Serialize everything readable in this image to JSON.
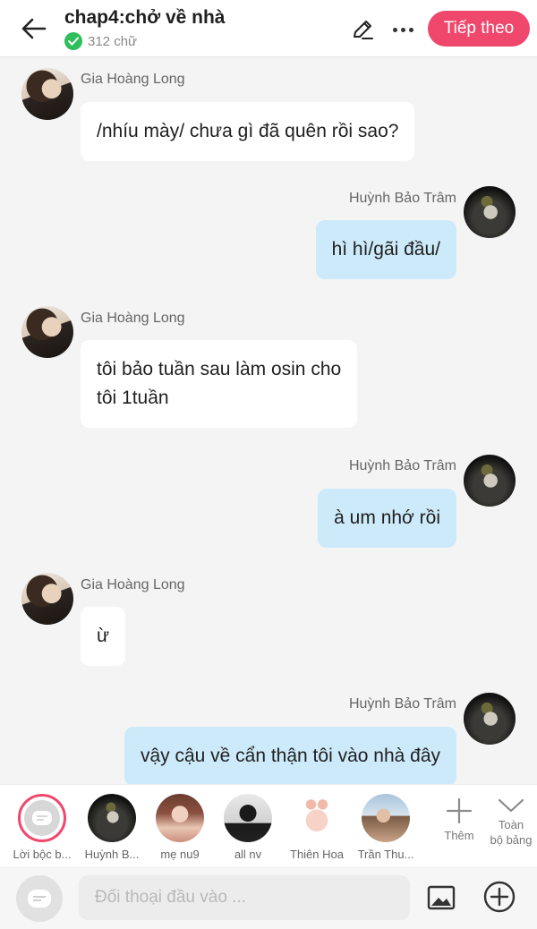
{
  "header": {
    "title": "chap4:chở về nhà",
    "word_count": "312 chữ",
    "next_label": "Tiếp theo"
  },
  "messages": [
    {
      "side": "left",
      "name": "Gia Hoàng Long",
      "line1": "/nhíu mày/ chưa gì đã quên rồi sao?",
      "line2": ""
    },
    {
      "side": "right",
      "name": "Huỳnh Bảo Trâm",
      "line1": "hì hì/gãi đầu/",
      "line2": ""
    },
    {
      "side": "left",
      "name": "Gia Hoàng Long",
      "line1": "tôi bảo tuần sau làm osin cho",
      "line2": "tôi 1tuần"
    },
    {
      "side": "right",
      "name": "Huỳnh Bảo Trâm",
      "line1": "à um nhớ rồi",
      "line2": ""
    },
    {
      "side": "left",
      "name": "Gia Hoàng Long",
      "line1": "ừ",
      "line2": ""
    },
    {
      "side": "right",
      "name": "Huỳnh Bảo Trâm",
      "line1": "vậy cậu về cẩn thận tôi vào nhà đây",
      "line2": ""
    }
  ],
  "characters": [
    {
      "label": "Lời bộc b..."
    },
    {
      "label": "Huỳnh B..."
    },
    {
      "label": "mẹ nu9"
    },
    {
      "label": "all nv"
    },
    {
      "label": "Thiên Hoa"
    },
    {
      "label": "Trần Thu..."
    }
  ],
  "char_more": {
    "add_label": "Thêm",
    "all_label_1": "Toàn",
    "all_label_2": "bộ bảng"
  },
  "input": {
    "placeholder": "Đối thoại đầu vào ..."
  },
  "colors": {
    "accent": "#f0476c",
    "right_bubble": "#cdeafa",
    "left_bubble": "#ffffff",
    "background": "#f4f4f4"
  }
}
